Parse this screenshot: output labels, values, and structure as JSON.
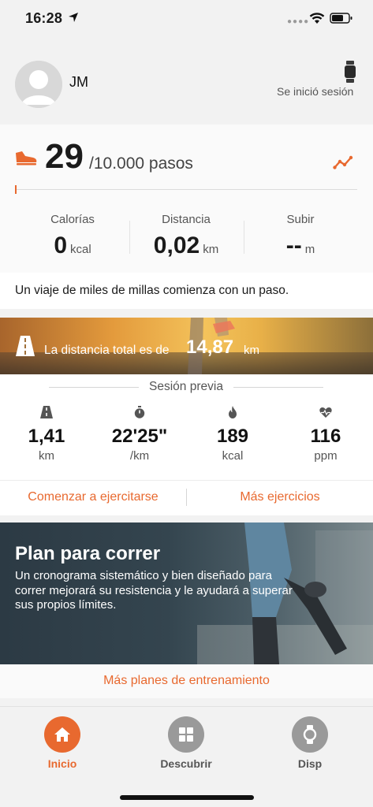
{
  "status_bar": {
    "time": "16:28"
  },
  "profile": {
    "name": "JM",
    "session_status": "Se inició sesión"
  },
  "steps": {
    "count": "29",
    "goal": "/10.000 pasos",
    "progress_fraction": 0.0029,
    "stats": [
      {
        "label": "Calorías",
        "value": "0",
        "unit": "kcal"
      },
      {
        "label": "Distancia",
        "value": "0,02",
        "unit": "km"
      },
      {
        "label": "Subir",
        "value": "--",
        "unit": "m"
      }
    ],
    "quote": "Un viaje de miles de millas comienza con un paso."
  },
  "total_distance": {
    "label": "La distancia total es de",
    "value": "14,87",
    "unit": "km"
  },
  "previous_session": {
    "title": "Sesión previa",
    "metrics": [
      {
        "icon": "road-icon",
        "value": "1,41",
        "unit": "km"
      },
      {
        "icon": "stopwatch-icon",
        "value": "22'25\"",
        "unit": "/km"
      },
      {
        "icon": "flame-icon",
        "value": "189",
        "unit": "kcal"
      },
      {
        "icon": "heart-rate-icon",
        "value": "116",
        "unit": "ppm"
      }
    ]
  },
  "actions": {
    "start": "Comenzar a ejercitarse",
    "more": "Más ejercicios"
  },
  "plan": {
    "title": "Plan para correr",
    "description": "Un cronograma sistemático y bien diseñado para correr mejorará su resistencia y le ayudará a superar sus propios límites.",
    "more_plans": "Más planes de entrenamiento"
  },
  "tabs": [
    {
      "label": "Inicio",
      "icon": "home-icon",
      "active": true
    },
    {
      "label": "Descubrir",
      "icon": "grid-icon",
      "active": false
    },
    {
      "label": "Disp",
      "icon": "watch-icon",
      "active": false
    }
  ],
  "colors": {
    "accent": "#e8692f",
    "inactive_tab": "#9a9a9a",
    "tab_label_inactive": "#555555"
  }
}
